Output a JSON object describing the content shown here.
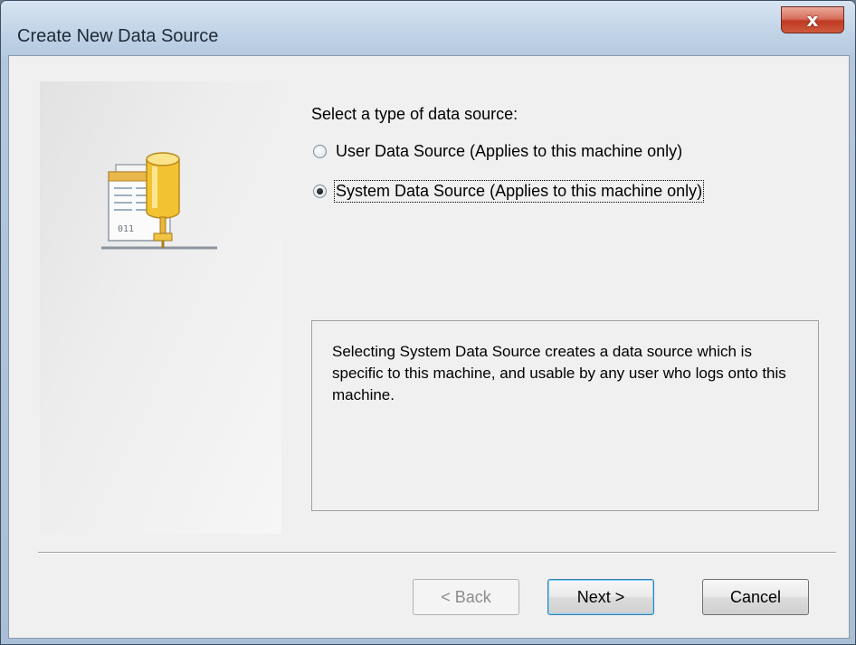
{
  "window": {
    "title": "Create New Data Source",
    "close_symbol": "x"
  },
  "icons": {
    "left_panel": "database-network-icon",
    "close": "close-icon"
  },
  "icon_text": "011",
  "main": {
    "prompt": "Select a type of data source:",
    "options": [
      {
        "label": "User Data Source (Applies to this machine only)",
        "selected": false
      },
      {
        "label": "System Data Source (Applies to this machine only)",
        "selected": true
      }
    ],
    "description": "Selecting System Data Source creates a data source which is specific to this machine, and usable by any user who logs onto this machine."
  },
  "buttons": {
    "back": "< Back",
    "next": "Next >",
    "cancel": "Cancel"
  },
  "colors": {
    "close_button": "#c9492f",
    "dialog_bg": "#f0f0f0",
    "default_button_border": "#3c7fb1"
  }
}
